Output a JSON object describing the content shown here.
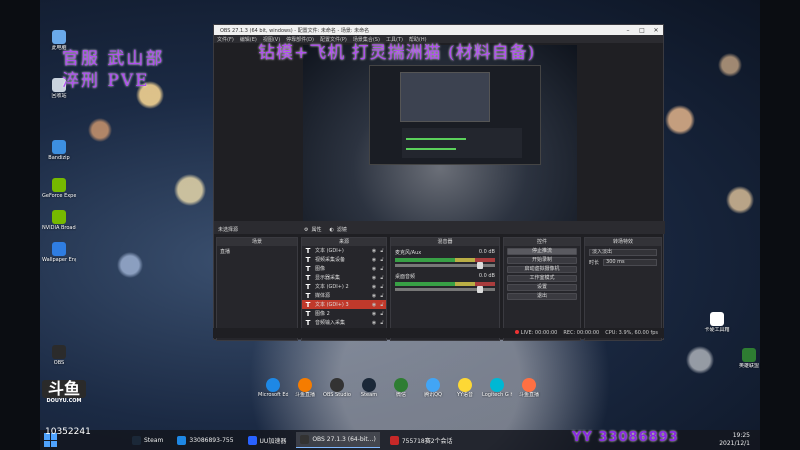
{
  "overlay": {
    "line1": "官服  武山部",
    "line2": "淬刑  PVE",
    "top_banner": "钻模+飞机  打灵揣洲猫 (材料自备)",
    "yy": "YY 33086893",
    "viewer_count": "10352241",
    "douyu_big": "斗鱼",
    "douyu_small": "DOUYU.COM"
  },
  "desktop_icons_left": [
    {
      "label": "此电脑",
      "color": "#6aa9e9"
    },
    {
      "label": "回收站",
      "color": "#c9d3de"
    },
    {
      "label": "Bandizip",
      "color": "#3d8fe0"
    },
    {
      "label": "GeForce Experience",
      "color": "#76b900"
    },
    {
      "label": "NVIDIA Broadcast",
      "color": "#76b900"
    },
    {
      "label": "Wallpaper Engine",
      "color": "#2f7de1"
    },
    {
      "label": "OBS",
      "color": "#2b2b2b"
    }
  ],
  "desktop_icons_right": [
    {
      "label": "卡硬工具箱",
      "color": "#ffffff"
    },
    {
      "label": "英雄联盟",
      "color": "#2e7d32"
    }
  ],
  "obs": {
    "title": "OBS 27.1.3 (64 bit, windows) - 配置文件: 未命名 - 场景: 未命名",
    "menu": [
      "文件(F)",
      "编辑(E)",
      "视图(V)",
      "停靠部件(D)",
      "配置文件(P)",
      "场景集合(S)",
      "工具(T)",
      "帮助(H)"
    ],
    "dock_label": "未选择源",
    "properties_label": "属性",
    "filters_label": "滤镜",
    "panels": {
      "scenes": "场景",
      "sources": "来源",
      "mixer": "混音器",
      "controls": "控件",
      "transitions": "转场特效"
    },
    "scenes": [
      "直播"
    ],
    "sources": [
      {
        "name": "文本 (GDI+)",
        "selected": false
      },
      {
        "name": "视频采集设备",
        "selected": false
      },
      {
        "name": "图像",
        "selected": false
      },
      {
        "name": "显示器采集",
        "selected": false
      },
      {
        "name": "文本 (GDI+) 2",
        "selected": false
      },
      {
        "name": "媒体源",
        "selected": false
      },
      {
        "name": "文本 (GDI+) 3",
        "selected": true
      },
      {
        "name": "图像 2",
        "selected": false
      },
      {
        "name": "音频输入采集",
        "selected": false
      }
    ],
    "mixer": [
      {
        "name": "麦克风/Aux",
        "db": "0.0 dB"
      },
      {
        "name": "桌面音频",
        "db": "0.0 dB"
      }
    ],
    "controls": [
      "停止推流",
      "开始录制",
      "启动虚拟摄像机",
      "工作室模式",
      "设置",
      "退出"
    ],
    "transitions": {
      "type": "淡入淡出",
      "duration_label": "时长",
      "duration": "300 ms"
    },
    "status": {
      "live": "LIVE: 00:00:00",
      "rec": "REC: 00:00:00",
      "cpu": "CPU: 3.9%, 60.00 fps"
    }
  },
  "taskbar_pinned": [
    {
      "label": "Microsoft Edge",
      "color": "#1e88e5"
    },
    {
      "label": "斗鱼直播",
      "color": "#f57c00"
    },
    {
      "label": "OBS Studio",
      "color": "#333333"
    },
    {
      "label": "Steam",
      "color": "#1b2838"
    },
    {
      "label": "微信",
      "color": "#2e7d32"
    },
    {
      "label": "腾讯QQ",
      "color": "#42a5f5"
    },
    {
      "label": "YY语音",
      "color": "#fdd835"
    },
    {
      "label": "Logitech G HUB",
      "color": "#00b8d4"
    },
    {
      "label": "斗鱼直播",
      "color": "#ff7043"
    }
  ],
  "taskbar": {
    "tasks": [
      {
        "label": "Steam",
        "color": "#1b2838",
        "active": false
      },
      {
        "label": "33086893-755",
        "color": "#1e88e5",
        "active": false
      },
      {
        "label": "UU加速器",
        "color": "#2962ff",
        "active": false
      },
      {
        "label": "OBS 27.1.3 (64-bit...)",
        "color": "#333333",
        "active": true
      },
      {
        "label": "755718赛2个会话",
        "color": "#c62828",
        "active": false
      }
    ],
    "time": "19:25",
    "date": "2021/12/1"
  }
}
